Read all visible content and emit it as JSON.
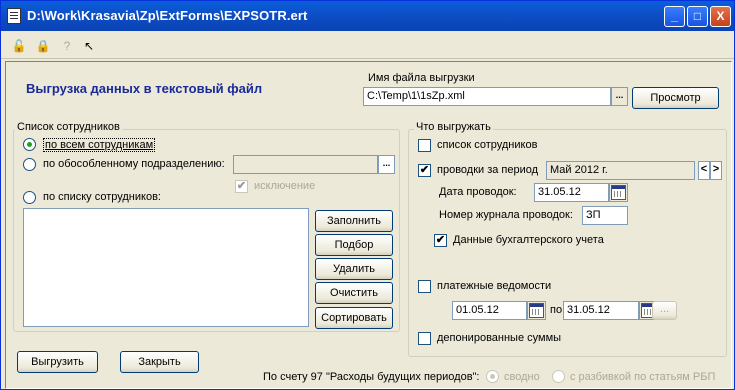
{
  "window": {
    "title": "D:\\Work\\Krasavia\\Zp\\ExtForms\\EXPSOTR.ert",
    "min": "_",
    "max": "□",
    "close": "X"
  },
  "header": {
    "title": "Выгрузка данных в текстовый файл",
    "file_label": "Имя файла выгрузки",
    "file_value": "C:\\Temp\\1\\1sZp.xml",
    "browse_label": "...",
    "preview_label": "Просмотр"
  },
  "employees": {
    "group_label": "Список сотрудников",
    "radio_all": "по всем сотрудникам",
    "radio_dept": "по обособленному подразделению:",
    "dept_value": "",
    "dept_browse": "...",
    "exclude_label": "исключение",
    "radio_list": "по списку сотрудников:",
    "buttons": [
      "Заполнить",
      "Подбор",
      "Удалить",
      "Очистить",
      "Сортировать"
    ]
  },
  "export": {
    "group_label": "Что выгружать",
    "emp_list": "список сотрудников",
    "postings": "проводки за период",
    "period": "Май 2012 г.",
    "prev": "<",
    "next": ">",
    "date_label": "Дата проводок:",
    "date_value": "31.05.12",
    "journal_label": "Номер журнала проводок:",
    "journal_value": "ЗП",
    "acc_data": "Данные бухгалтерского учета",
    "payroll": "платежные ведомости",
    "from": "01.05.12",
    "to_label": "по",
    "to": "31.05.12",
    "dots": "...",
    "deposited": "депонированные суммы",
    "check": "✔"
  },
  "footer": {
    "export_btn": "Выгрузить",
    "close_btn": "Закрыть",
    "account_label": "По счету 97 \"Расходы будущих периодов\":",
    "opt1": "сводно",
    "opt2": "с разбивкой по статьям РБП"
  }
}
